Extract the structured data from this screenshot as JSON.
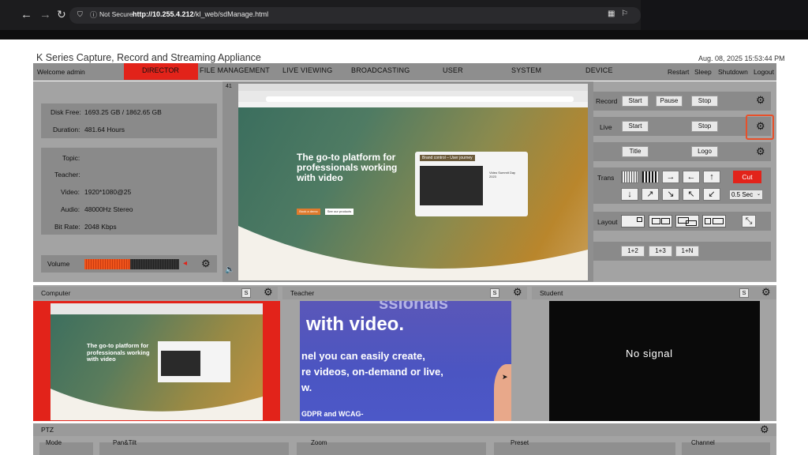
{
  "browser": {
    "url_host": "http://10.255.4.212",
    "url_path": "/kl_web/sdManage.html",
    "security": "Not Secure"
  },
  "app": {
    "title": "K Series Capture, Record and Streaming Appliance",
    "datetime": "Aug. 08, 2025 15:53:44 PM",
    "welcome": "Welcome admin"
  },
  "menu": [
    "DIRECTOR",
    "FILE MANAGEMENT",
    "LIVE VIEWING",
    "BROADCASTING",
    "USER",
    "SYSTEM",
    "DEVICE"
  ],
  "menu_right": [
    "Restart",
    "Sleep",
    "Shutdown",
    "Logout"
  ],
  "status": {
    "disk_label": "Disk Free:",
    "disk_value": "1693.25 GB / 1862.65 GB",
    "duration_label": "Duration:",
    "duration_value": "481.64 Hours"
  },
  "meta": {
    "topic_label": "Topic:",
    "topic_value": "",
    "teacher_label": "Teacher:",
    "teacher_value": "",
    "video_label": "Video:",
    "video_value": "1920*1080@25",
    "audio_label": "Audio:",
    "audio_value": "48000Hz Stereo",
    "bitrate_label": "Bit Rate:",
    "bitrate_value": "2048 Kbps"
  },
  "volume": {
    "label": "Volume",
    "level": 0.48
  },
  "preview": {
    "badge": "41",
    "headline1": "The go-to platform for",
    "headline2": "professionals working",
    "headline3": "with video",
    "card_title": "Brand control – User journey",
    "btn1": "Book a demo",
    "btn2": "See our products",
    "card_label": "Video Summit Day 2023"
  },
  "controls": {
    "record": {
      "label": "Record",
      "start": "Start",
      "pause": "Pause",
      "stop": "Stop"
    },
    "live": {
      "label": "Live",
      "start": "Start",
      "stop": "Stop"
    },
    "overlay": {
      "title": "Title",
      "logo": "Logo"
    },
    "trans": {
      "label": "Trans",
      "cut": "Cut",
      "duration": "0.5 Sec"
    },
    "layout": {
      "label": "Layout"
    },
    "combo": [
      "1+2",
      "1+3",
      "1+N"
    ]
  },
  "cameras": [
    {
      "name": "Computer",
      "s": "S"
    },
    {
      "name": "Teacher",
      "s": "S"
    },
    {
      "name": "Student",
      "s": "S"
    }
  ],
  "teacher_view": {
    "line1": "ssionals",
    "line2": "with video.",
    "line3": "nel you can easily create,",
    "line4": "re videos, on-demand or live,",
    "line5": "w.",
    "line6": "GDPR and WCAG-"
  },
  "student_view": {
    "text": "No signal"
  },
  "ptz": {
    "label": "PTZ",
    "cols": [
      "Mode",
      "Pan&Tilt",
      "Zoom",
      "Preset",
      "Channel"
    ]
  },
  "colors": {
    "accent": "#e2231a",
    "panel": "#8a8a8a"
  }
}
